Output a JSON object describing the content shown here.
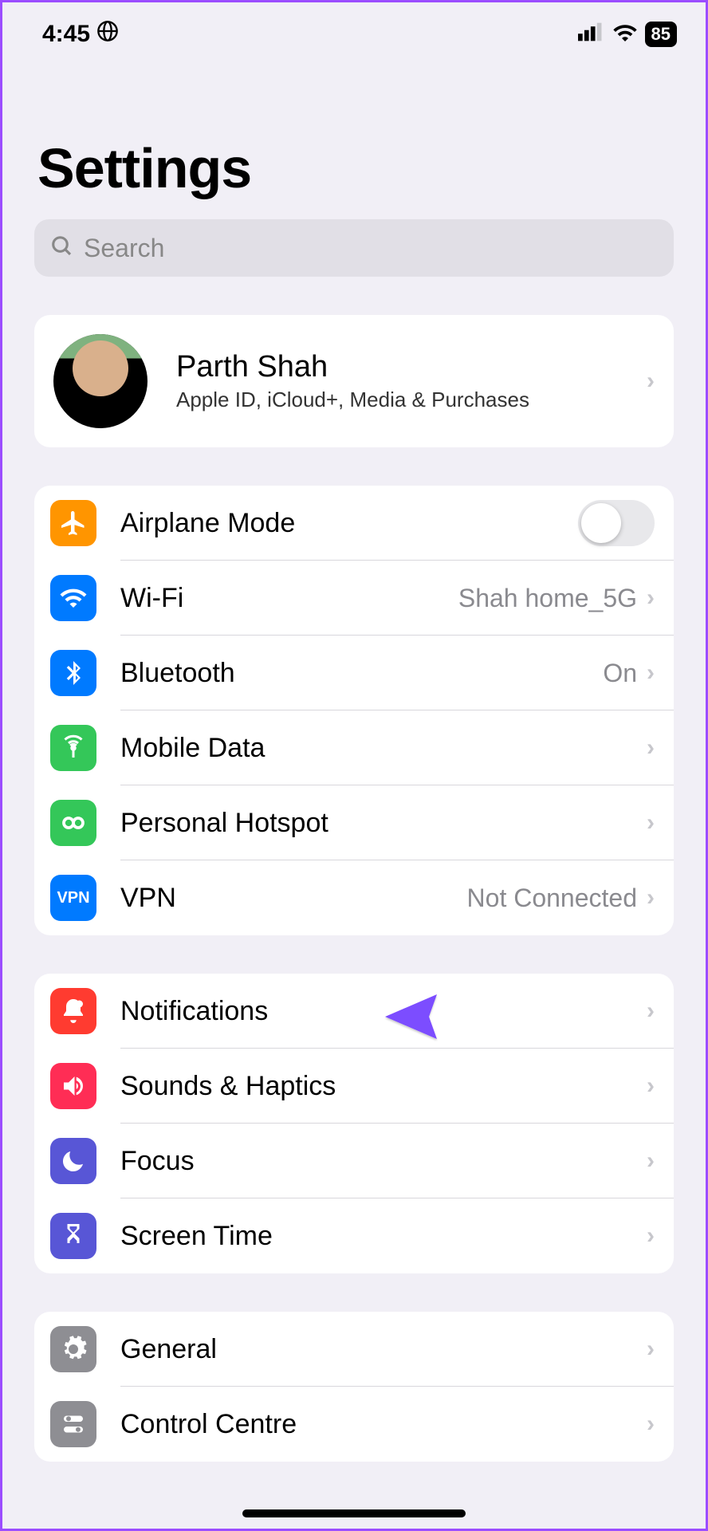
{
  "status": {
    "time": "4:45",
    "battery": "85"
  },
  "header": {
    "title": "Settings"
  },
  "search": {
    "placeholder": "Search"
  },
  "account": {
    "name": "Parth Shah",
    "subtitle": "Apple ID, iCloud+, Media & Purchases"
  },
  "g1": {
    "airplane": "Airplane Mode",
    "wifi": "Wi-Fi",
    "wifi_val": "Shah home_5G",
    "bluetooth": "Bluetooth",
    "bluetooth_val": "On",
    "mobile": "Mobile Data",
    "hotspot": "Personal Hotspot",
    "vpn": "VPN",
    "vpn_val": "Not Connected",
    "vpn_badge": "VPN"
  },
  "g2": {
    "notifications": "Notifications",
    "sounds": "Sounds & Haptics",
    "focus": "Focus",
    "screentime": "Screen Time"
  },
  "g3": {
    "general": "General",
    "control": "Control Centre"
  },
  "colors": {
    "orange": "#ff9500",
    "blue": "#007aff",
    "green": "#34c759",
    "red": "#ff3b30",
    "pink": "#ff2d55",
    "indigo": "#5856d6",
    "grey": "#8e8e93"
  }
}
